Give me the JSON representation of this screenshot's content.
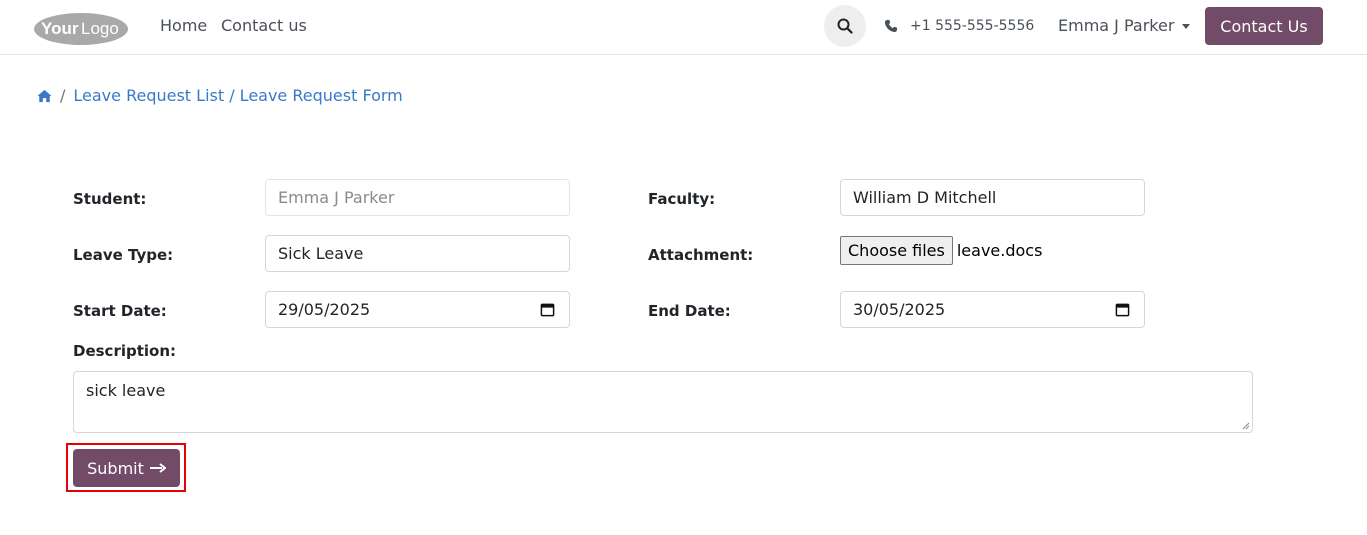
{
  "header": {
    "logo_text": "YourLogo",
    "nav": [
      {
        "label": "Home"
      },
      {
        "label": "Contact us"
      }
    ],
    "phone": "+1 555-555-5556",
    "user_name": "Emma J Parker",
    "contact_button": "Contact Us",
    "search_icon": "search-icon"
  },
  "breadcrumb": {
    "home_icon": "home-icon",
    "separator": "/",
    "link": "Leave Request List / Leave Request Form"
  },
  "form": {
    "student": {
      "label": "Student:",
      "value": "Emma J Parker"
    },
    "faculty": {
      "label": "Faculty:",
      "value": "William D Mitchell"
    },
    "leave_type": {
      "label": "Leave Type:",
      "value": "Sick Leave"
    },
    "attachment": {
      "label": "Attachment:",
      "button": "Choose files",
      "file": "leave.docs"
    },
    "start_date": {
      "label": "Start Date:",
      "value": "29/05/2025"
    },
    "end_date": {
      "label": "End Date:",
      "value": "30/05/2025"
    },
    "description": {
      "label": "Description:",
      "value": "sick leave"
    },
    "submit": "Submit"
  },
  "colors": {
    "primary": "#714b67",
    "link": "#3a79c9",
    "highlight": "#e60000"
  }
}
